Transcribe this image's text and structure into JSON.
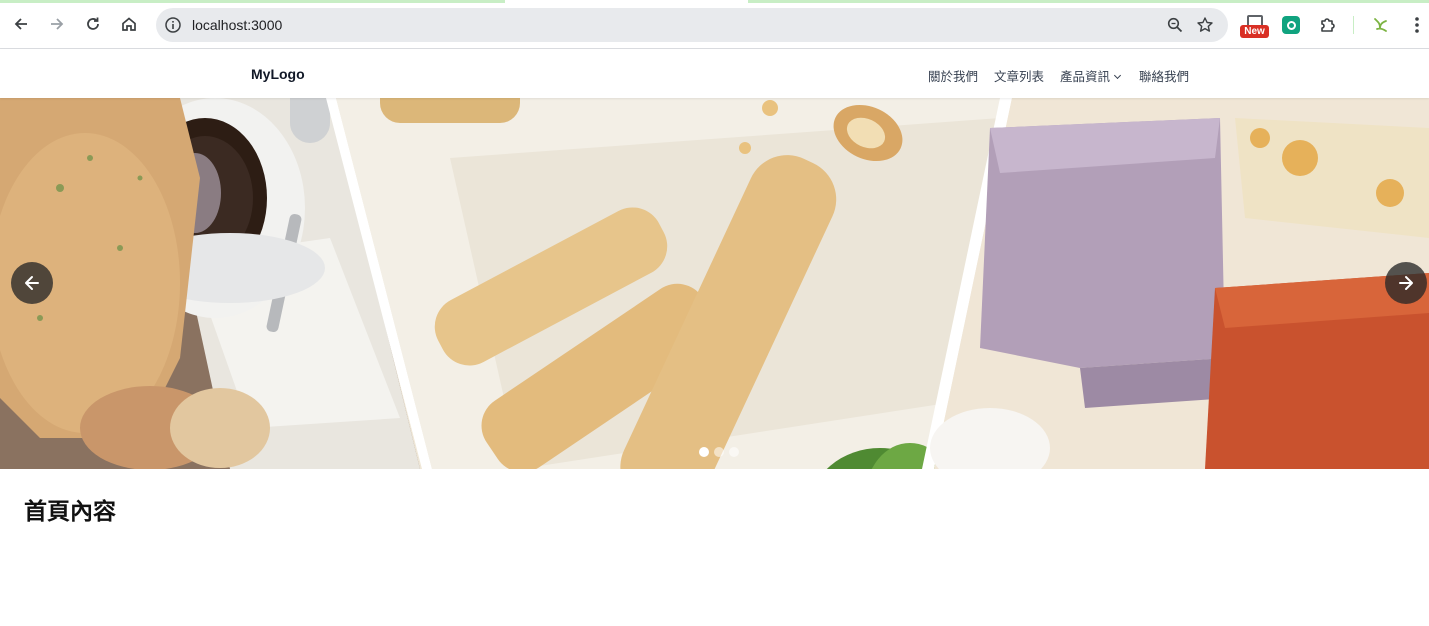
{
  "browser": {
    "url": "localhost:3000",
    "extension_badge": "New",
    "icons": [
      "back-icon",
      "forward-icon",
      "reload-icon",
      "home-icon",
      "site-info-icon",
      "zoom-icon",
      "bookmark-star-icon",
      "extension-new-icon",
      "chatgpt-extension-icon",
      "extensions-puzzle-icon",
      "profile-icon",
      "menu-icon"
    ]
  },
  "header": {
    "logo": "MyLogo",
    "nav": [
      {
        "label": "關於我們"
      },
      {
        "label": "文章列表"
      },
      {
        "label": "產品資訊",
        "has_dropdown": true
      },
      {
        "label": "聯絡我們"
      }
    ]
  },
  "carousel": {
    "slide_count": 3,
    "active_slide": 1,
    "icons": [
      "arrow-left-icon",
      "arrow-right-icon"
    ]
  },
  "main": {
    "title": "首頁內容"
  },
  "colors": {
    "accent_bar": "#c8eec5",
    "nav_text": "#374151",
    "arrow_bg": "#282828"
  }
}
